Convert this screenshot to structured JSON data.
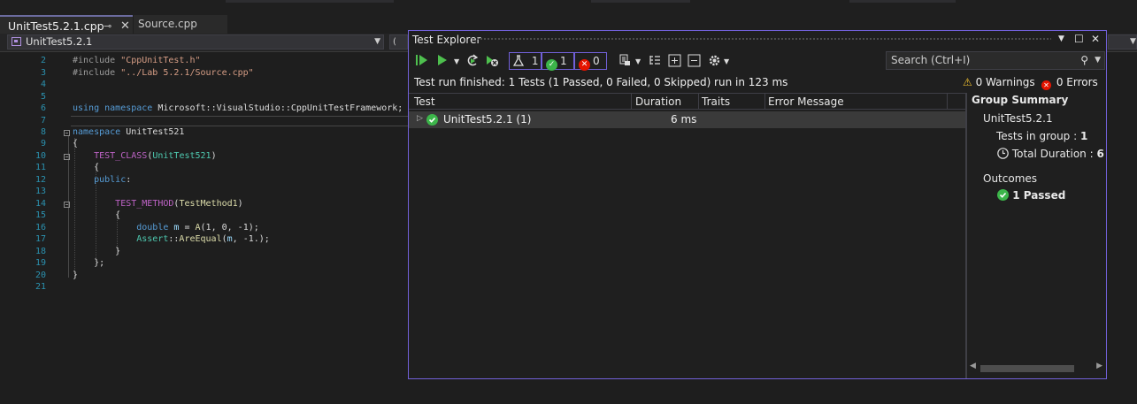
{
  "tabs": [
    {
      "label": "UnitTest5.2.1.cpp",
      "active": true
    },
    {
      "label": "Source.cpp",
      "active": false
    }
  ],
  "nav": {
    "project": "UnitTest5.2.1"
  },
  "editor": {
    "line_numbers": [
      "2",
      "3",
      "4",
      "5",
      "6",
      "7",
      "8",
      "9",
      "10",
      "11",
      "12",
      "13",
      "14",
      "15",
      "16",
      "17",
      "18",
      "19",
      "20",
      "21"
    ],
    "lines": {
      "l2": {
        "pp": "#include ",
        "str": "\"CppUnitTest.h\""
      },
      "l3": {
        "pp": "#include ",
        "str": "\"../Lab 5.2.1/Source.cpp\""
      },
      "l6": {
        "kw1": "using",
        "kw2": "namespace",
        "rest": "Microsoft::VisualStudio::CppUnitTestFramework;"
      },
      "l8": {
        "kw": "namespace",
        "name": "UnitTest521"
      },
      "l9": "{",
      "l10": {
        "mac": "TEST_CLASS",
        "arg": "UnitTest521"
      },
      "l11": "{",
      "l12": {
        "kw": "public",
        "rest": ":"
      },
      "l14": {
        "mac": "TEST_METHOD",
        "arg": "TestMethod1"
      },
      "l15": "{",
      "l16": {
        "kw": "double",
        "var": "m",
        "fn": "A",
        "args": "(1, 0, -1);"
      },
      "l17": {
        "typ": "Assert",
        "fn": "AreEqual",
        "var": "m",
        "rest": ", -1.);"
      },
      "l18": "}",
      "l19": "};",
      "l20": "}"
    }
  },
  "test_explorer": {
    "title": "Test Explorer",
    "counters": {
      "total": "1",
      "passed": "1",
      "failed": "0"
    },
    "search_placeholder": "Search (Ctrl+I)",
    "status": "Test run finished: 1 Tests (1 Passed, 0 Failed, 0 Skipped) run in 123 ms",
    "warnings": "0 Warnings",
    "errors": "0 Errors",
    "columns": [
      "Test",
      "Duration",
      "Traits",
      "Error Message"
    ],
    "rows": [
      {
        "name": "UnitTest5.2.1  (1)",
        "duration": "6 ms",
        "outcome": "passed"
      }
    ],
    "summary": {
      "title": "Group Summary",
      "group": "UnitTest5.2.1",
      "tests_in_group_label": "Tests in group",
      "tests_in_group_value": "1",
      "total_duration_label": "Total Duration",
      "total_duration_value": "6",
      "outcomes_label": "Outcomes",
      "passed": "1 Passed"
    },
    "colors": {
      "accent": "#7160d8",
      "pass": "#3cb54a",
      "fail": "#e51400",
      "warn": "#f2c12e"
    }
  }
}
